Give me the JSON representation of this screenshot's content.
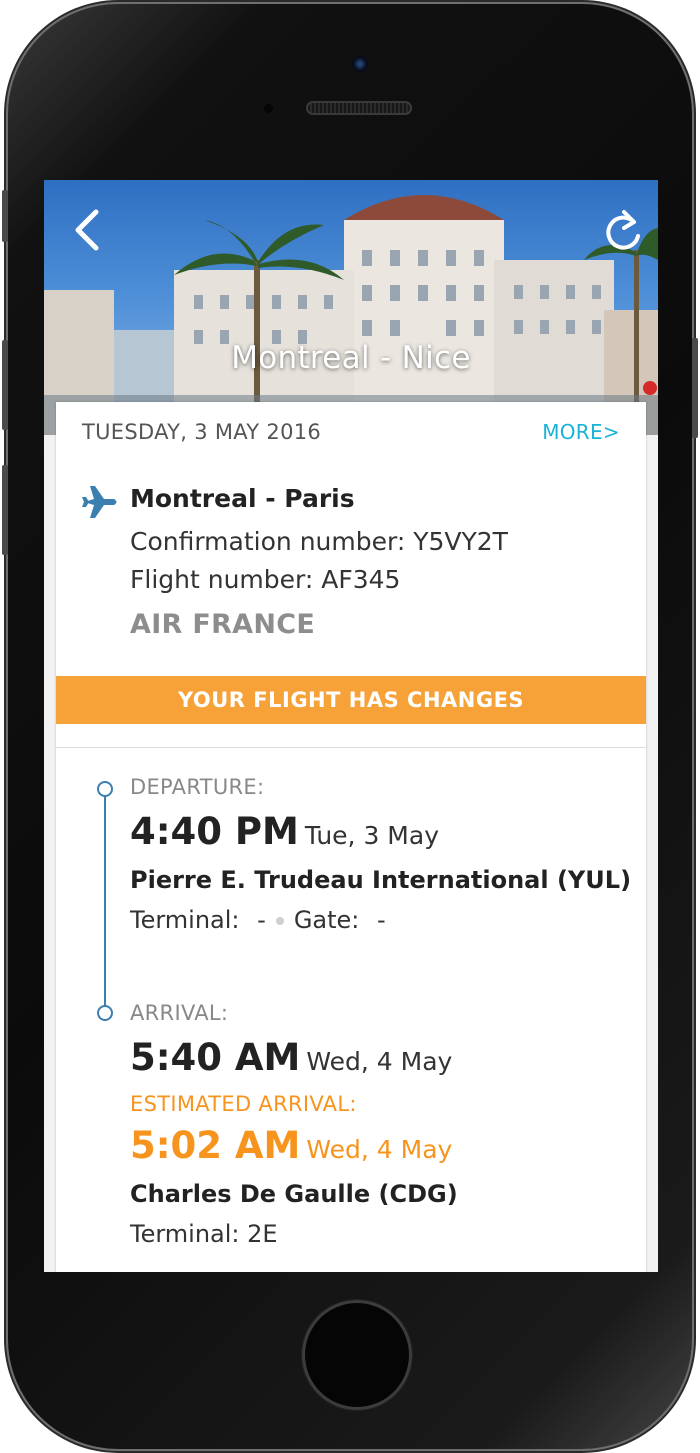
{
  "header": {
    "title": "Montreal - Nice",
    "back_icon": "chevron-left-icon",
    "refresh_icon": "refresh-icon"
  },
  "trip": {
    "date": "TUESDAY, 3 MAY 2016",
    "more_label": "MORE>",
    "route": "Montreal - Paris",
    "confirmation": "Confirmation number: Y5VY2T",
    "flight_number": "Flight number: AF345",
    "airline": "AIR FRANCE",
    "plane_icon": "airplane-icon"
  },
  "alert": {
    "text": "YOUR FLIGHT HAS CHANGES"
  },
  "departure": {
    "label": "DEPARTURE:",
    "time": "4:40 PM",
    "day": "Tue, 3 May",
    "airport": "Pierre E. Trudeau International (YUL)",
    "terminal_label": "Terminal:",
    "terminal_value": "-",
    "gate_label": "Gate:",
    "gate_value": "-"
  },
  "arrival": {
    "label": "ARRIVAL:",
    "time": "5:40 AM",
    "day": "Wed, 4 May",
    "estimated_label": "ESTIMATED ARRIVAL:",
    "estimated_time": "5:02 AM",
    "estimated_day": "Wed, 4 May",
    "airport": "Charles De Gaulle (CDG)",
    "terminal": "Terminal: 2E"
  },
  "colors": {
    "accent": "#1ab2d8",
    "alert": "#f7a139",
    "estimated": "#f7941d",
    "timeline": "#3a7fb0"
  }
}
